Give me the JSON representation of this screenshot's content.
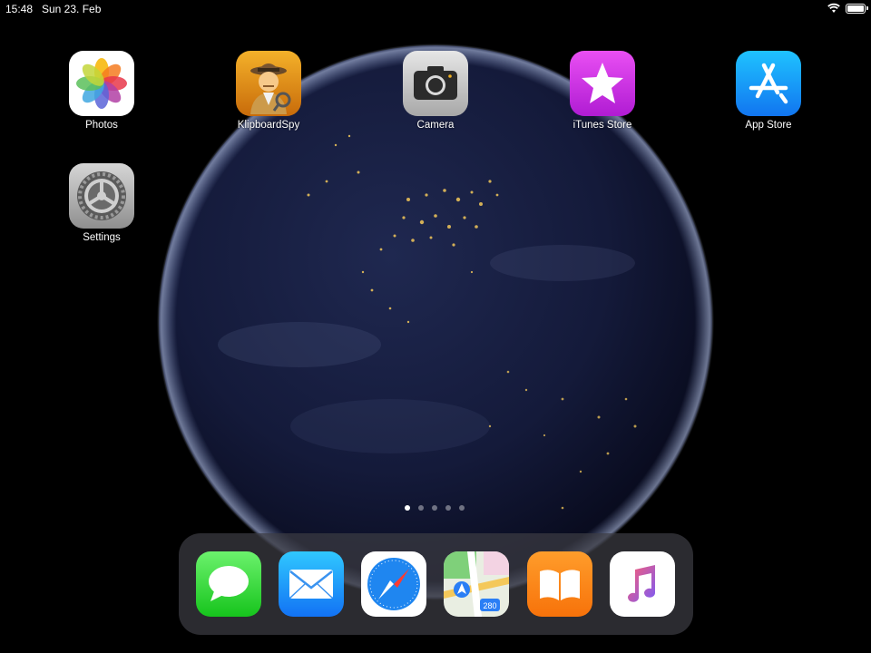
{
  "status_bar": {
    "time": "15:48",
    "date": "Sun 23. Feb",
    "wifi_icon": "wifi-icon",
    "battery_icon": "battery-icon"
  },
  "home_apps": [
    {
      "label": "Photos",
      "icon": "photos-icon"
    },
    {
      "label": "KlipboardSpy",
      "icon": "detective-icon"
    },
    {
      "label": "Camera",
      "icon": "camera-icon"
    },
    {
      "label": "iTunes Store",
      "icon": "star-icon"
    },
    {
      "label": "App Store",
      "icon": "app-store-icon"
    },
    {
      "label": "Settings",
      "icon": "gear-icon"
    }
  ],
  "page_indicator": {
    "pages": 5,
    "current": 1
  },
  "dock_apps": [
    {
      "name": "Messages",
      "icon": "messages-icon"
    },
    {
      "name": "Mail",
      "icon": "mail-icon"
    },
    {
      "name": "Safari",
      "icon": "compass-icon"
    },
    {
      "name": "Maps",
      "icon": "maps-icon"
    },
    {
      "name": "Books",
      "icon": "book-icon"
    },
    {
      "name": "Music",
      "icon": "music-note-icon"
    }
  ],
  "colors": {
    "background": "#000000",
    "earth": "#14193a",
    "city_lights": "#f3c85a"
  }
}
